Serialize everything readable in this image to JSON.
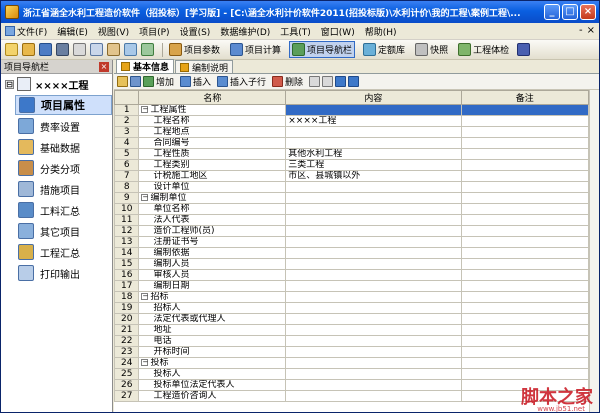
{
  "window": {
    "title": "浙江省涵全水利工程造价软件（招投标）[学习版] - [C:\\涵全水利计价软件2011(招投标版)\\水利计价\\我的工程\\案例工程\\...",
    "controls": [
      "_",
      "□",
      "×"
    ]
  },
  "menu": {
    "items": [
      "文件(F)",
      "编辑(E)",
      "视图(V)",
      "项目(P)",
      "设置(S)",
      "数据维护(D)",
      "工具(T)",
      "窗口(W)",
      "帮助(H)"
    ],
    "mdi_controls": [
      "-",
      "×"
    ]
  },
  "toolbar": {
    "buttons": [
      "项目参数",
      "项目计算",
      "项目导航栏",
      "定额库",
      "快照",
      "工程体检"
    ],
    "active": "项目导航栏"
  },
  "sidebar": {
    "header": "项目导航栏",
    "close": "×",
    "project": "××××工程",
    "expander": "⊟",
    "items": [
      "项目属性",
      "费率设置",
      "基础数据",
      "分类分项",
      "措施项目",
      "工料汇总",
      "其它项目",
      "工程汇总",
      "打印输出"
    ],
    "active_index": 0
  },
  "tabs": [
    "基本信息",
    "编制说明"
  ],
  "subtoolbar": {
    "buttons": [
      "增加",
      "插入",
      "插入子行",
      "删除"
    ]
  },
  "grid": {
    "columns": [
      "名称",
      "内容",
      "备注"
    ],
    "rows": [
      {
        "n": "1",
        "name": "工程属性",
        "content": "",
        "level": 0,
        "group": true,
        "selected": true
      },
      {
        "n": "2",
        "name": "工程名称",
        "content": "××××工程",
        "level": 1
      },
      {
        "n": "3",
        "name": "工程地点",
        "content": "",
        "level": 1
      },
      {
        "n": "4",
        "name": "合同编号",
        "content": "",
        "level": 1
      },
      {
        "n": "5",
        "name": "工程性质",
        "content": "其他水利工程",
        "level": 1
      },
      {
        "n": "6",
        "name": "工程类别",
        "content": "三类工程",
        "level": 1
      },
      {
        "n": "7",
        "name": "计税施工地区",
        "content": "市区、县城镇以外",
        "level": 1
      },
      {
        "n": "8",
        "name": "设计单位",
        "content": "",
        "level": 1
      },
      {
        "n": "9",
        "name": "编制单位",
        "content": "",
        "level": 0,
        "group": true
      },
      {
        "n": "10",
        "name": "单位名称",
        "content": "",
        "level": 1
      },
      {
        "n": "11",
        "name": "法人代表",
        "content": "",
        "level": 1
      },
      {
        "n": "12",
        "name": "造价工程师(员)",
        "content": "",
        "level": 1
      },
      {
        "n": "13",
        "name": "注册证书号",
        "content": "",
        "level": 1
      },
      {
        "n": "14",
        "name": "编制依据",
        "content": "",
        "level": 1
      },
      {
        "n": "15",
        "name": "编制人员",
        "content": "",
        "level": 1
      },
      {
        "n": "16",
        "name": "审核人员",
        "content": "",
        "level": 1
      },
      {
        "n": "17",
        "name": "编制日期",
        "content": "",
        "level": 1
      },
      {
        "n": "18",
        "name": "招标",
        "content": "",
        "level": 0,
        "group": true
      },
      {
        "n": "19",
        "name": "招标人",
        "content": "",
        "level": 1
      },
      {
        "n": "20",
        "name": "法定代表或代理人",
        "content": "",
        "level": 1
      },
      {
        "n": "21",
        "name": "地址",
        "content": "",
        "level": 1
      },
      {
        "n": "22",
        "name": "电话",
        "content": "",
        "level": 1
      },
      {
        "n": "23",
        "name": "开标时间",
        "content": "",
        "level": 1
      },
      {
        "n": "24",
        "name": "投标",
        "content": "",
        "level": 0,
        "group": true
      },
      {
        "n": "25",
        "name": "投标人",
        "content": "",
        "level": 1
      },
      {
        "n": "26",
        "name": "投标单位法定代表人",
        "content": "",
        "level": 1
      },
      {
        "n": "27",
        "name": "工程造价咨询人",
        "content": "",
        "level": 1
      }
    ]
  },
  "watermark": {
    "text": "脚本之家",
    "url": "www.jb51.net"
  },
  "colors": {
    "titlebar": "#0a5fe0",
    "selection": "#316ac5",
    "chrome": "#ece9d8"
  }
}
